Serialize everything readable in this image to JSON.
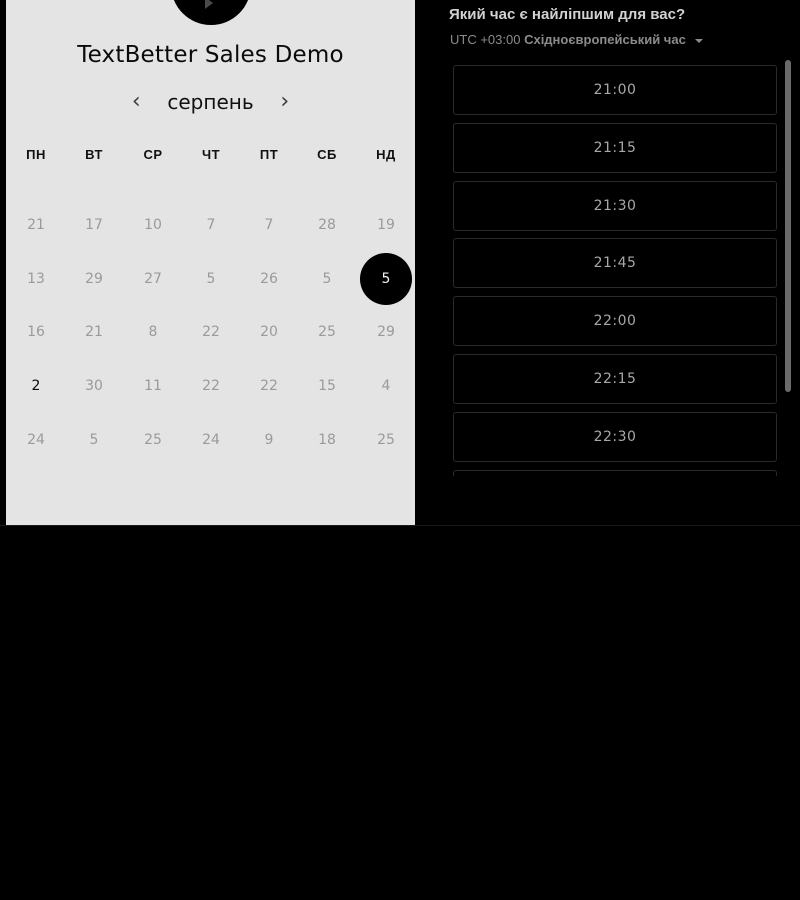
{
  "event": {
    "title": "TextBetter Sales Demo"
  },
  "calendar": {
    "month": "серпень",
    "prev_icon": "chevron-left-icon",
    "next_icon": "chevron-right-icon",
    "weekdays": [
      "ПН",
      "ВТ",
      "СР",
      "ЧТ",
      "ПТ",
      "СБ",
      "НД"
    ],
    "weeks": [
      [
        "21",
        "17",
        "10",
        "7",
        "7",
        "28",
        "19"
      ],
      [
        "13",
        "29",
        "27",
        "5",
        "26",
        "5",
        "5"
      ],
      [
        "16",
        "21",
        "8",
        "22",
        "20",
        "25",
        "29"
      ],
      [
        "2",
        "30",
        "11",
        "22",
        "22",
        "15",
        "4"
      ],
      [
        "24",
        "5",
        "25",
        "24",
        "9",
        "18",
        "25"
      ]
    ],
    "selected": {
      "week": 1,
      "day": 6
    },
    "available": [
      {
        "week": 3,
        "day": 0
      }
    ]
  },
  "times": {
    "question": "Який час є найліпшим для вас?",
    "timezone_offset": "UTC +03:00",
    "timezone_name": "Східноєвропейський час",
    "slots": [
      "21:00",
      "21:15",
      "21:30",
      "21:45",
      "22:00",
      "22:15",
      "22:30",
      ""
    ]
  },
  "colors": {
    "calendar_bg": "#e4e4e4",
    "page_bg": "#000000",
    "selected_day_bg": "#000000"
  }
}
